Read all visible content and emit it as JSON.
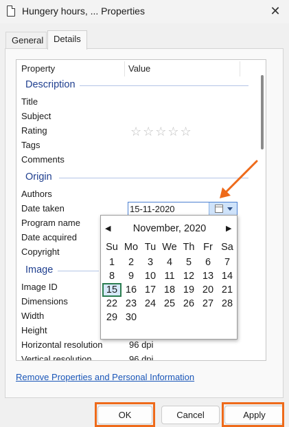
{
  "window": {
    "title": "Hungery hours, ... Properties",
    "close_glyph": "✕"
  },
  "tabs": [
    {
      "label": "General"
    },
    {
      "label": "Details"
    }
  ],
  "list": {
    "headers": {
      "property": "Property",
      "value": "Value"
    },
    "sections": [
      {
        "title": "Description",
        "rows": [
          {
            "label": "Title",
            "value": ""
          },
          {
            "label": "Subject",
            "value": ""
          },
          {
            "label": "Rating",
            "value": "☆☆☆☆☆"
          },
          {
            "label": "Tags",
            "value": ""
          },
          {
            "label": "Comments",
            "value": ""
          }
        ]
      },
      {
        "title": "Origin",
        "rows": [
          {
            "label": "Authors",
            "value": ""
          },
          {
            "label": "Date taken",
            "value": "15-11-2020"
          },
          {
            "label": "Program name",
            "value": ""
          },
          {
            "label": "Date acquired",
            "value": ""
          },
          {
            "label": "Copyright",
            "value": ""
          }
        ]
      },
      {
        "title": "Image",
        "rows": [
          {
            "label": "Image ID",
            "value": ""
          },
          {
            "label": "Dimensions",
            "value": ""
          },
          {
            "label": "Width",
            "value": ""
          },
          {
            "label": "Height",
            "value": ""
          },
          {
            "label": "Horizontal resolution",
            "value": "96 dpi"
          },
          {
            "label": "Vertical resolution",
            "value": "96 dpi"
          }
        ]
      }
    ]
  },
  "calendar": {
    "prev_glyph": "◀",
    "next_glyph": "▶",
    "title": "November, 2020",
    "weekdays": [
      "Su",
      "Mo",
      "Tu",
      "We",
      "Th",
      "Fr",
      "Sa"
    ],
    "weeks": [
      [
        "",
        "",
        "",
        "",
        "",
        "",
        ""
      ],
      [
        "1",
        "2",
        "3",
        "4",
        "5",
        "6",
        "7"
      ],
      [
        "8",
        "9",
        "10",
        "11",
        "12",
        "13",
        "14"
      ],
      [
        "15",
        "16",
        "17",
        "18",
        "19",
        "20",
        "21"
      ],
      [
        "22",
        "23",
        "24",
        "25",
        "26",
        "27",
        "28"
      ],
      [
        "29",
        "30",
        "",
        "",
        "",
        "",
        ""
      ]
    ],
    "selected_day": "15"
  },
  "remove_link": "Remove Properties and Personal Information",
  "buttons": {
    "ok": "OK",
    "cancel": "Cancel",
    "apply": "Apply"
  },
  "colors": {
    "accent_highlight": "#ee6a1a",
    "section_heading": "#1f3f8f",
    "link": "#1a56b8",
    "selected_day_border": "#2a7d4f"
  }
}
